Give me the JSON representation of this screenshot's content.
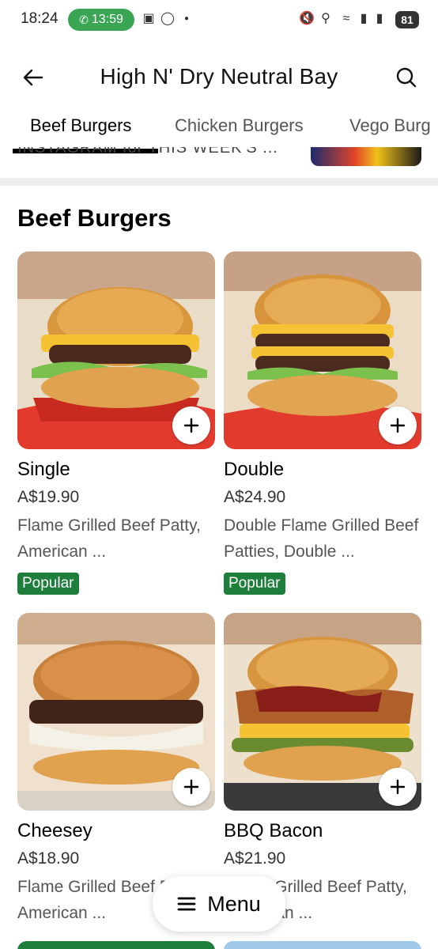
{
  "status_bar": {
    "time": "18:24",
    "call_time": "13:59",
    "battery": "81"
  },
  "header": {
    "title": "High N' Dry Neutral Bay"
  },
  "tabs": [
    {
      "label": "Beef Burgers",
      "active": true
    },
    {
      "label": "Chicken Burgers",
      "active": false
    },
    {
      "label": "Vego Burg",
      "active": false
    }
  ],
  "previous_section": {
    "text": "INSTAGRAM for THIS WEEK'S ..."
  },
  "section": {
    "title": "Beef Burgers"
  },
  "products": [
    {
      "name": "Single",
      "price": "A$19.90",
      "description": "Flame Grilled Beef Patty, American ...",
      "badge": "Popular"
    },
    {
      "name": "Double",
      "price": "A$24.90",
      "description": "Double Flame Grilled Beef Patties, Double ...",
      "badge": "Popular"
    },
    {
      "name": "Cheesey",
      "price": "A$18.90",
      "description": "Flame Grilled Beef Patty, American ...",
      "badge": ""
    },
    {
      "name": "BBQ Bacon",
      "price": "A$21.90",
      "description": "Flame Grilled Beef Patty, American ...",
      "badge": ""
    }
  ],
  "menu_button": {
    "label": "Menu"
  },
  "colors": {
    "badge_green": "#1e7f3d",
    "call_green": "#3aa655"
  }
}
